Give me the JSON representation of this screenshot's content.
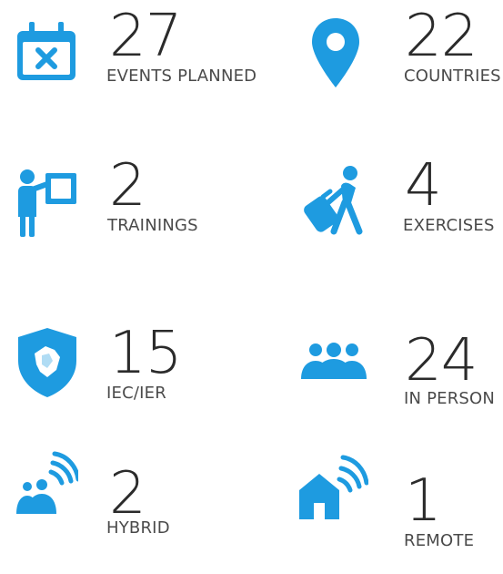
{
  "theme": {
    "accent": "#1e9be0",
    "text": "#2b2b2b",
    "label": "#4a4a4a"
  },
  "stats": [
    {
      "id": "events-planned",
      "value": "27",
      "label": "EVENTS PLANNED",
      "icon": "calendar-x-icon"
    },
    {
      "id": "countries",
      "value": "22",
      "label": "COUNTRIES",
      "icon": "map-pin-icon"
    },
    {
      "id": "trainings",
      "value": "2",
      "label": "TRAININGS",
      "icon": "presenter-board-icon"
    },
    {
      "id": "exercises",
      "value": "4",
      "label": "EXERCISES",
      "icon": "traveler-luggage-icon"
    },
    {
      "id": "iec-ier",
      "value": "15",
      "label": "IEC/IER",
      "icon": "shield-map-icon"
    },
    {
      "id": "in-person",
      "value": "24",
      "label": "IN PERSON",
      "icon": "people-group-icon"
    },
    {
      "id": "hybrid",
      "value": "2",
      "label": "HYBRID",
      "icon": "people-wifi-icon"
    },
    {
      "id": "remote",
      "value": "1",
      "label": "REMOTE",
      "icon": "home-wifi-icon"
    }
  ]
}
